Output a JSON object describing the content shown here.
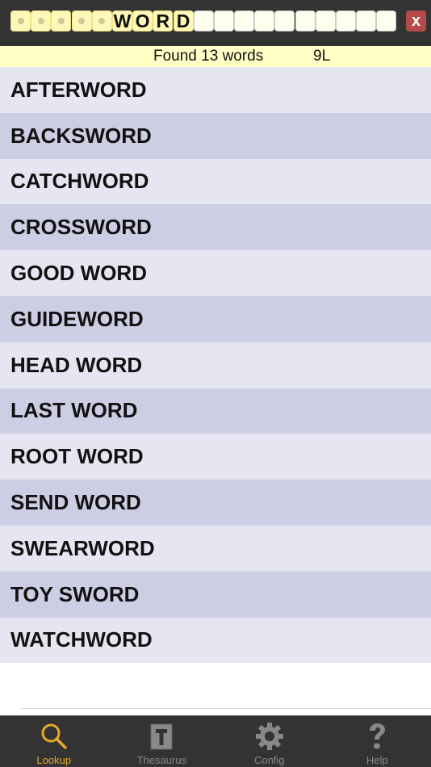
{
  "pattern": {
    "tiles": [
      "",
      "",
      "",
      "",
      "",
      "W",
      "O",
      "R",
      "D",
      "",
      "",
      "",
      "",
      "",
      "",
      "",
      "",
      "",
      ""
    ],
    "wildcard_count": 5,
    "clear_label": "x"
  },
  "status": {
    "found": "Found 13 words",
    "length": "9L"
  },
  "results": [
    "AFTERWORD",
    "BACKSWORD",
    "CATCHWORD",
    "CROSSWORD",
    "GOOD WORD",
    "GUIDEWORD",
    "HEAD WORD",
    "LAST WORD",
    "ROOT WORD",
    "SEND WORD",
    "SWEARWORD",
    "TOY SWORD",
    "WATCHWORD"
  ],
  "tabs": [
    {
      "label": "Lookup",
      "icon": "search-icon",
      "active": true
    },
    {
      "label": "Thesaurus",
      "icon": "book-icon",
      "active": false
    },
    {
      "label": "Config",
      "icon": "gear-icon",
      "active": false
    },
    {
      "label": "Help",
      "icon": "question-icon",
      "active": false
    }
  ],
  "colors": {
    "accent": "#e8a82a",
    "tile": "#fff8b8",
    "row_light": "#e6e6f2",
    "row_dark": "#cdcde4",
    "clear": "#b54a4a"
  }
}
